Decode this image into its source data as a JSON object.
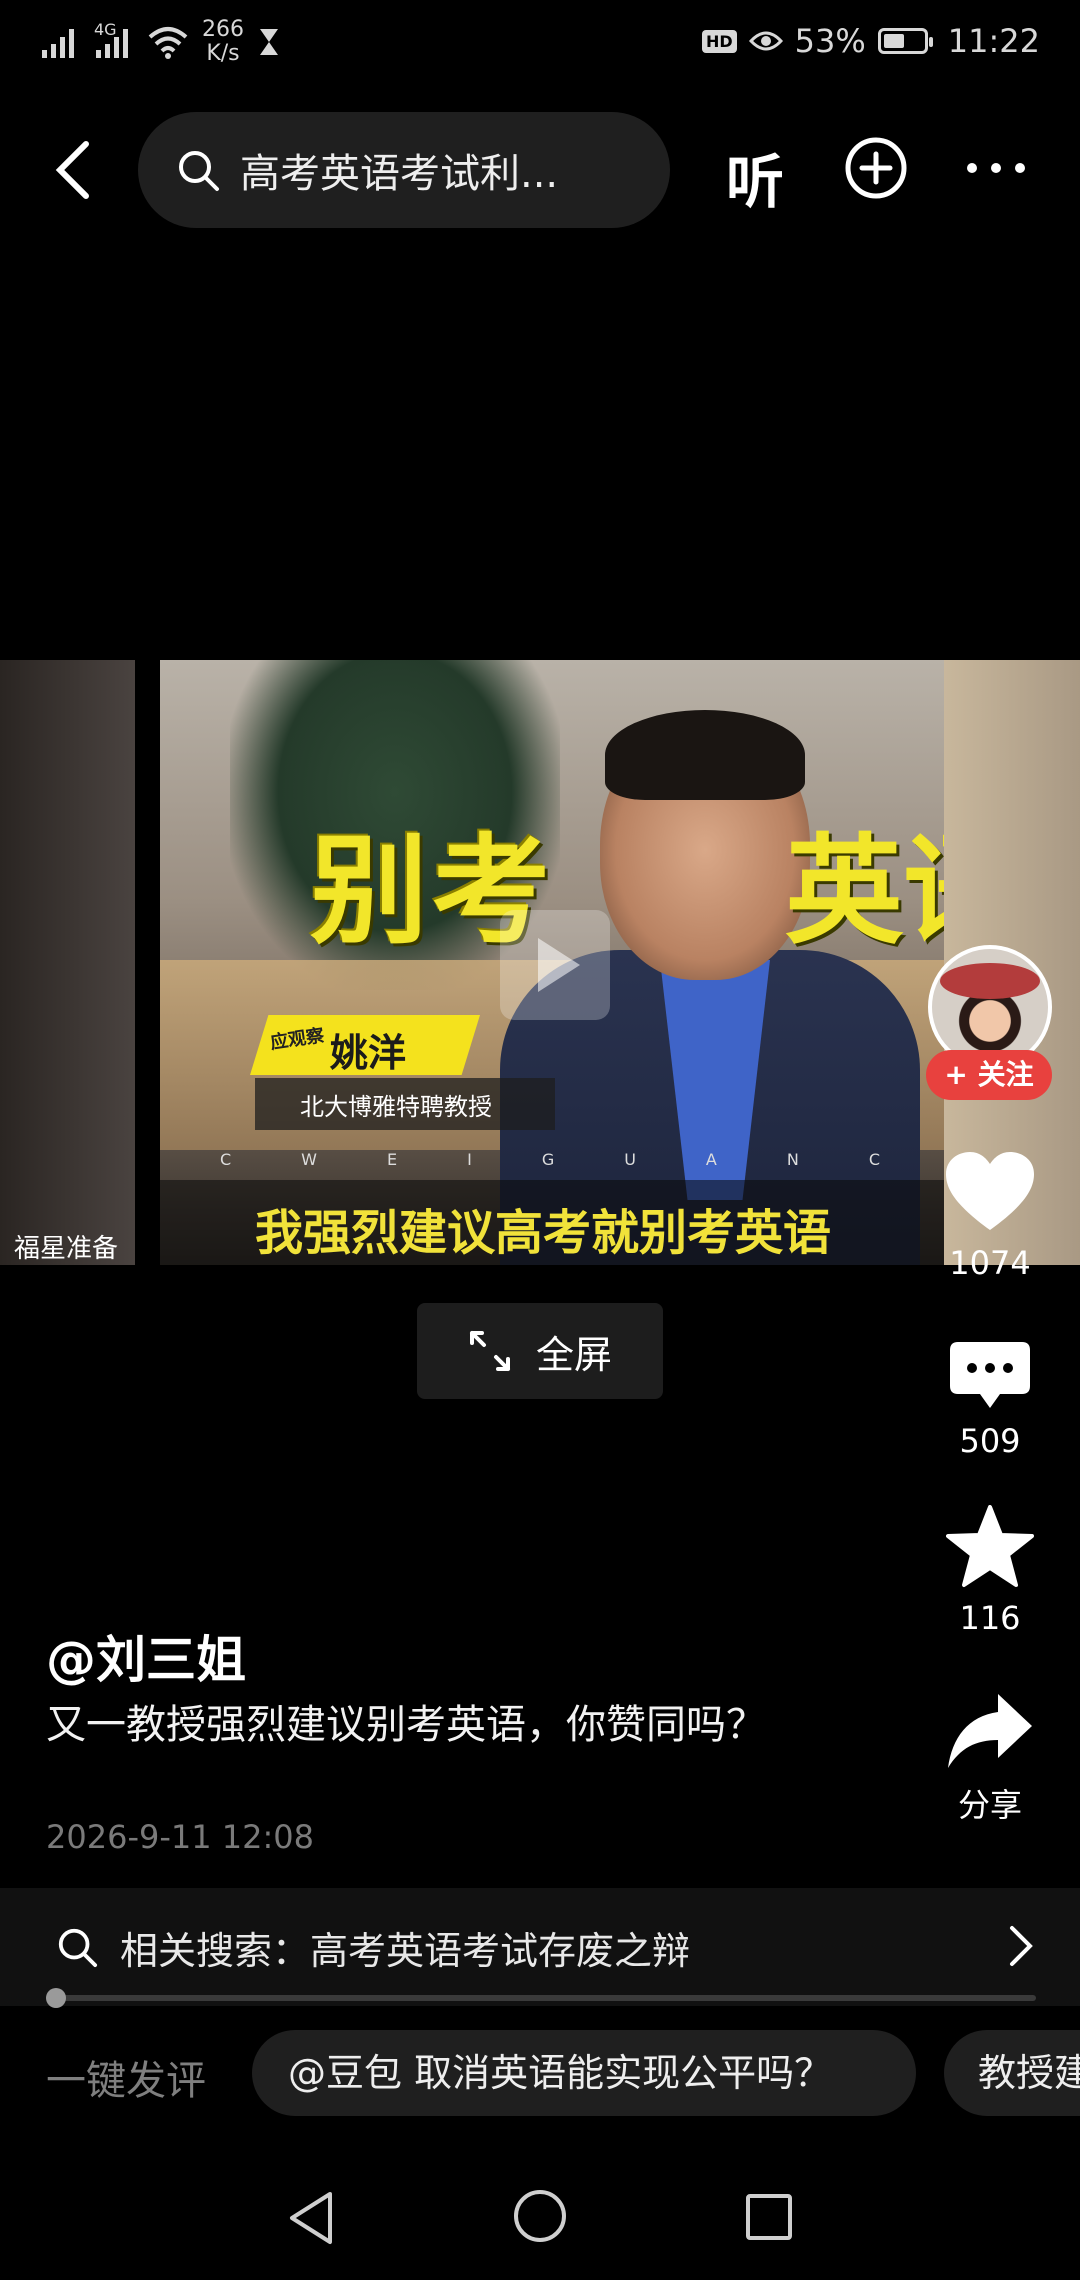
{
  "status_bar": {
    "net_speed_value": "266",
    "net_speed_unit": "K/s",
    "network_type": "4G",
    "battery_percent": "53%",
    "battery_level": 0.53,
    "hd_label": "HD",
    "time": "11:22"
  },
  "top_bar": {
    "search_query": "高考英语考试利...",
    "listen_label": "听"
  },
  "video": {
    "overlay_title_left": "别考",
    "overlay_title_right": "英语",
    "name_tag": "姚洋",
    "name_chip": "应观察",
    "person_title": "北大博雅特聘教授",
    "ticker": "CWEIGUANCHA",
    "subtitle": "我强烈建议高考就别考英语",
    "side_caption": "福星准备"
  },
  "fullscreen_label": "全屏",
  "actions": {
    "follow_label": "+ 关注",
    "like_count": "1074",
    "comment_count": "509",
    "favorite_count": "116",
    "share_label": "分享"
  },
  "post": {
    "author": "@刘三姐",
    "description": "又一教授强烈建议别考英语，你赞同吗？",
    "date": "2026-9-11 12:08"
  },
  "related_search": {
    "text": "相关搜索：高考英语考试存废之辩"
  },
  "progress": 0.0,
  "quick_comment": {
    "label": "一键发评",
    "chips": [
      "@豆包 取消英语能实现公平吗？",
      "教授建"
    ]
  },
  "colors": {
    "accent_red": "#e8413e",
    "subtitle_yellow": "#f1e23a",
    "background": "#000000"
  }
}
